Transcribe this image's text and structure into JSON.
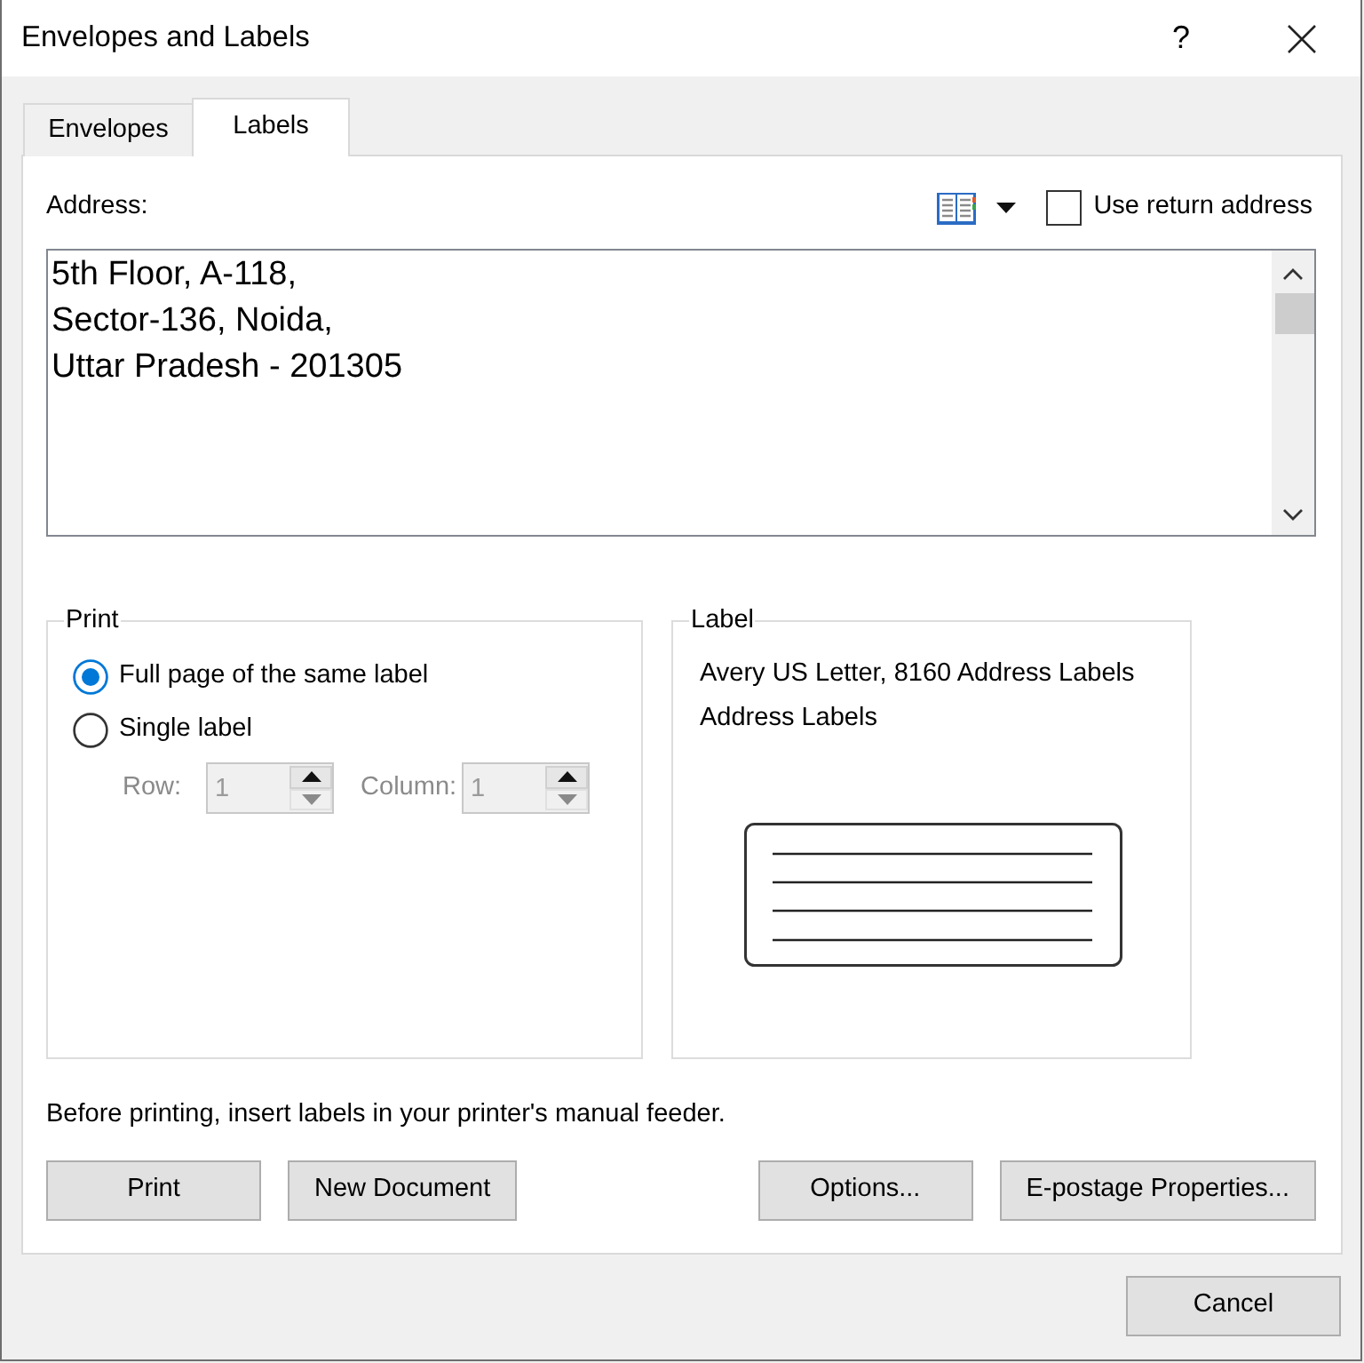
{
  "window": {
    "title": "Envelopes and Labels",
    "help": "?"
  },
  "tabs": [
    {
      "label": "Envelopes",
      "selected": false
    },
    {
      "label": "Labels",
      "selected": true
    }
  ],
  "address": {
    "label": "Address:",
    "lines": [
      "5th Floor, A-118,",
      "Sector-136, Noida,",
      "Uttar Pradesh - 201305"
    ]
  },
  "return_address": {
    "label": "Use return address",
    "checked": false
  },
  "print": {
    "title": "Print",
    "options": [
      {
        "label": "Full page of the same label",
        "selected": true
      },
      {
        "label": "Single label",
        "selected": false
      }
    ],
    "spinners": [
      {
        "label": "Row:",
        "value": "1",
        "disabled": true
      },
      {
        "label": "Column:",
        "value": "1",
        "disabled": true
      }
    ]
  },
  "label": {
    "title": "Label",
    "lines": [
      "Avery US Letter, 8160 Address Labels",
      "Address Labels"
    ]
  },
  "note": "Before printing, insert labels in your printer's manual feeder.",
  "button_groups": [
    {
      "buttons": [
        {
          "label": "Print"
        },
        {
          "label": "New Document"
        }
      ]
    },
    {
      "buttons": [
        {
          "label": "Options..."
        },
        {
          "label": "E-postage Properties..."
        }
      ]
    }
  ],
  "footer_buttons": [
    {
      "label": "Cancel"
    }
  ]
}
